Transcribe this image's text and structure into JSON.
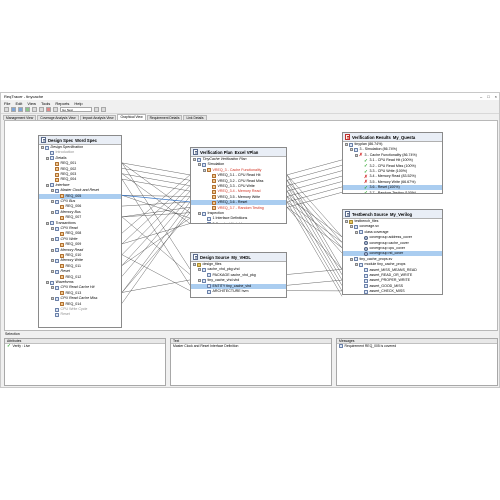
{
  "window": {
    "title": "ReqTracer - tinycache",
    "controls": [
      "–",
      "□",
      "×"
    ]
  },
  "menu": [
    "File",
    "Edit",
    "View",
    "Tools",
    "Reports",
    "Help"
  ],
  "toolbar": {
    "select_value": "Go Next"
  },
  "tabs": [
    {
      "label": "Management View",
      "active": false
    },
    {
      "label": "Coverage Analysis View",
      "active": false
    },
    {
      "label": "Impact Analysis View",
      "active": false
    },
    {
      "label": "Graphical View",
      "active": true
    },
    {
      "label": "Requirement Details",
      "active": false
    },
    {
      "label": "Link Details",
      "active": false
    }
  ],
  "panels": {
    "design_spec": {
      "title": "Design Spec",
      "subtitle": "Word Spec",
      "rows": [
        {
          "text": "Design Specification",
          "icon": "page",
          "exp": "-",
          "indent": 0,
          "style": "t-italic"
        },
        {
          "text": "Introduction",
          "icon": "page",
          "exp": "",
          "indent": 1,
          "style": "t-grey"
        },
        {
          "text": "Details",
          "icon": "page",
          "exp": "-",
          "indent": 1,
          "style": "t-italic"
        },
        {
          "text": "REQ_001",
          "icon": "req",
          "exp": "",
          "indent": 2,
          "style": ""
        },
        {
          "text": "REQ_002",
          "icon": "req",
          "exp": "",
          "indent": 2,
          "style": ""
        },
        {
          "text": "REQ_003",
          "icon": "req",
          "exp": "",
          "indent": 2,
          "style": ""
        },
        {
          "text": "REQ_004",
          "icon": "req",
          "exp": "",
          "indent": 2,
          "style": ""
        },
        {
          "text": "Interface",
          "icon": "page",
          "exp": "-",
          "indent": 1,
          "style": "t-italic"
        },
        {
          "text": "Master Clock and Reset",
          "icon": "page",
          "exp": "-",
          "indent": 2,
          "style": "t-italic"
        },
        {
          "text": "REQ_005",
          "icon": "req",
          "exp": "",
          "indent": 3,
          "style": "",
          "selected": true
        },
        {
          "text": "CPU Bus",
          "icon": "page",
          "exp": "-",
          "indent": 2,
          "style": "t-italic"
        },
        {
          "text": "REQ_006",
          "icon": "req",
          "exp": "",
          "indent": 3,
          "style": ""
        },
        {
          "text": "Memory Bus",
          "icon": "page",
          "exp": "-",
          "indent": 2,
          "style": "t-italic"
        },
        {
          "text": "REQ_007",
          "icon": "req",
          "exp": "",
          "indent": 3,
          "style": ""
        },
        {
          "text": "Transactions",
          "icon": "page",
          "exp": "-",
          "indent": 1,
          "style": "t-italic"
        },
        {
          "text": "CPU Read",
          "icon": "page",
          "exp": "-",
          "indent": 2,
          "style": "t-italic"
        },
        {
          "text": "REQ_008",
          "icon": "req",
          "exp": "",
          "indent": 3,
          "style": ""
        },
        {
          "text": "CPU Write",
          "icon": "page",
          "exp": "-",
          "indent": 2,
          "style": "t-italic"
        },
        {
          "text": "REQ_009",
          "icon": "req",
          "exp": "",
          "indent": 3,
          "style": ""
        },
        {
          "text": "Memory Read",
          "icon": "page",
          "exp": "-",
          "indent": 2,
          "style": "t-italic"
        },
        {
          "text": "REQ_010",
          "icon": "req",
          "exp": "",
          "indent": 3,
          "style": ""
        },
        {
          "text": "Memory Write",
          "icon": "page",
          "exp": "-",
          "indent": 2,
          "style": "t-italic"
        },
        {
          "text": "REQ_011",
          "icon": "req",
          "exp": "",
          "indent": 3,
          "style": ""
        },
        {
          "text": "Reset",
          "icon": "page",
          "exp": "-",
          "indent": 2,
          "style": "t-italic"
        },
        {
          "text": "REQ_012",
          "icon": "req",
          "exp": "",
          "indent": 3,
          "style": ""
        },
        {
          "text": "Waveforms",
          "icon": "page",
          "exp": "-",
          "indent": 1,
          "style": "t-italic"
        },
        {
          "text": "CPU Read Cache Hit",
          "icon": "page",
          "exp": "-",
          "indent": 2,
          "style": "t-italic"
        },
        {
          "text": "REQ_013",
          "icon": "req",
          "exp": "",
          "indent": 3,
          "style": ""
        },
        {
          "text": "CPU Read Cache Miss",
          "icon": "page",
          "exp": "-",
          "indent": 2,
          "style": "t-italic"
        },
        {
          "text": "REQ_014",
          "icon": "req",
          "exp": "",
          "indent": 3,
          "style": ""
        },
        {
          "text": "CPU Write Cycle",
          "icon": "page",
          "exp": "",
          "indent": 2,
          "style": "t-grey"
        },
        {
          "text": "Reset",
          "icon": "page",
          "exp": "",
          "indent": 2,
          "style": "t-grey"
        }
      ]
    },
    "verification_plan": {
      "title": "Verification Plan",
      "subtitle": "Excel VPlan",
      "rows": [
        {
          "text": "TinyCache Verification Plan",
          "icon": "page",
          "exp": "-",
          "indent": 0,
          "style": "t-italic"
        },
        {
          "text": "Simulation",
          "icon": "page",
          "exp": "-",
          "indent": 1,
          "style": ""
        },
        {
          "text": "VREQ_3 - Cache Functionality",
          "icon": "req",
          "exp": "-",
          "indent": 2,
          "style": "t-red"
        },
        {
          "text": "VREQ_3.1 - CPU Read Hit",
          "icon": "req",
          "exp": "",
          "indent": 3,
          "style": ""
        },
        {
          "text": "VREQ_3.2 - CPU Read Miss",
          "icon": "req",
          "exp": "",
          "indent": 3,
          "style": ""
        },
        {
          "text": "VREQ_3.3 - CPU Write",
          "icon": "req",
          "exp": "",
          "indent": 3,
          "style": ""
        },
        {
          "text": "VREQ_3.4 - Memory Read",
          "icon": "req",
          "exp": "",
          "indent": 3,
          "style": "t-red"
        },
        {
          "text": "VREQ_3.5 - Memory Write",
          "icon": "req",
          "exp": "",
          "indent": 3,
          "style": ""
        },
        {
          "text": "VREQ_3.6 - Reset",
          "icon": "req",
          "exp": "",
          "indent": 3,
          "style": "",
          "selected": true
        },
        {
          "text": "VREQ_3.7 - Random Testing",
          "icon": "req",
          "exp": "",
          "indent": 3,
          "style": "t-red"
        },
        {
          "text": "Inspection",
          "icon": "page",
          "exp": "-",
          "indent": 1,
          "style": ""
        },
        {
          "text": "1 Interface Definitions",
          "icon": "page",
          "exp": "",
          "indent": 2,
          "style": ""
        },
        {
          "text": "2 Constant Variables",
          "icon": "page",
          "exp": "",
          "indent": 2,
          "style": ""
        }
      ]
    },
    "design_source": {
      "title": "Design Source",
      "subtitle": "My_VHDL",
      "rows": [
        {
          "text": "design_files",
          "icon": "folder",
          "exp": "-",
          "indent": 0,
          "style": ""
        },
        {
          "text": "cache_vhd_pkg.vhd",
          "icon": "page",
          "exp": "-",
          "indent": 1,
          "style": ""
        },
        {
          "text": "PACKAGE cache_vhd_pkg",
          "icon": "page",
          "exp": "",
          "indent": 2,
          "style": ""
        },
        {
          "text": "tiny_cache_vhd.vhd",
          "icon": "page",
          "exp": "-",
          "indent": 1,
          "style": ""
        },
        {
          "text": "ENTITY tiny_cache_vhd",
          "icon": "page",
          "exp": "",
          "indent": 2,
          "style": "",
          "selected": true
        },
        {
          "text": "ARCHITECTURE hvm",
          "icon": "page",
          "exp": "",
          "indent": 2,
          "style": ""
        }
      ]
    },
    "verification_results": {
      "title": "Verification Results",
      "subtitle": "My_Questa",
      "rows": [
        {
          "text": "tinyplan (86.74%)",
          "icon": "page",
          "exp": "-",
          "indent": 0,
          "style": ""
        },
        {
          "text": "3 - Simulation (86.74%)",
          "icon": "page",
          "exp": "-",
          "indent": 1,
          "style": ""
        },
        {
          "text": "3 - Cache Functionality (86.74%)",
          "icon": "cross",
          "exp": "-",
          "indent": 2,
          "style": ""
        },
        {
          "text": "3.1 - CPU Read Hit (100%)",
          "icon": "check",
          "exp": "",
          "indent": 3,
          "style": ""
        },
        {
          "text": "3.2 - CPU Read Miss (100%)",
          "icon": "check",
          "exp": "",
          "indent": 3,
          "style": ""
        },
        {
          "text": "3.3 - CPU Write (100%)",
          "icon": "check",
          "exp": "",
          "indent": 3,
          "style": ""
        },
        {
          "text": "3.4 - Memory Read (83.52%)",
          "icon": "cross",
          "exp": "",
          "indent": 3,
          "style": ""
        },
        {
          "text": "3.5 - Memory Write (66.67%)",
          "icon": "cross",
          "exp": "",
          "indent": 3,
          "style": ""
        },
        {
          "text": "3.6 - Reset (100%)",
          "icon": "check",
          "exp": "",
          "indent": 3,
          "style": "",
          "selected": true
        },
        {
          "text": "3.7 - Random Testing (100%)",
          "icon": "check",
          "exp": "",
          "indent": 3,
          "style": ""
        }
      ]
    },
    "testbench_source": {
      "title": "Testbench Source",
      "subtitle": "My_Verilog",
      "rows": [
        {
          "text": "testbench_files",
          "icon": "folder",
          "exp": "-",
          "indent": 0,
          "style": ""
        },
        {
          "text": "coverage.sv",
          "icon": "page",
          "exp": "-",
          "indent": 1,
          "style": ""
        },
        {
          "text": "class coverage",
          "icon": "page",
          "exp": "-",
          "indent": 2,
          "style": ""
        },
        {
          "text": "covergroup address_cover",
          "icon": "gear",
          "exp": "",
          "indent": 3,
          "style": ""
        },
        {
          "text": "covergroup cache_cover",
          "icon": "gear",
          "exp": "",
          "indent": 3,
          "style": ""
        },
        {
          "text": "covergroup cpu_cover",
          "icon": "gear",
          "exp": "",
          "indent": 3,
          "style": ""
        },
        {
          "text": "covergroup rst_cover",
          "icon": "gear",
          "exp": "",
          "indent": 3,
          "style": "",
          "selected": true
        },
        {
          "text": "tiny_cache_props.sv",
          "icon": "page",
          "exp": "-",
          "indent": 1,
          "style": ""
        },
        {
          "text": "module tiny_cache_props",
          "icon": "page",
          "exp": "-",
          "indent": 2,
          "style": ""
        },
        {
          "text": "assert_MISS_MEANS_READ",
          "icon": "page",
          "exp": "",
          "indent": 3,
          "style": ""
        },
        {
          "text": "assert_READ_OR_WRITE",
          "icon": "page",
          "exp": "",
          "indent": 3,
          "style": ""
        },
        {
          "text": "assert_PROPER_WRITE",
          "icon": "page",
          "exp": "",
          "indent": 3,
          "style": ""
        },
        {
          "text": "assert_GOOD_MISS",
          "icon": "page",
          "exp": "",
          "indent": 3,
          "style": ""
        },
        {
          "text": "assert_CHECK_MISS",
          "icon": "page",
          "exp": "",
          "indent": 3,
          "style": ""
        },
        {
          "text": "assert_MEM_WR_MEANS_CPU_WR",
          "icon": "page",
          "exp": "",
          "indent": 3,
          "style": ""
        }
      ]
    }
  },
  "bottom": {
    "section_title": "Selection",
    "attributes": {
      "header": "Attributes",
      "row": "Verify : Live"
    },
    "text": {
      "header": "Text",
      "row": "Master Clock and Reset Interface Definition"
    },
    "messages": {
      "header": "Messages",
      "row": "Requirement REQ_005 is covered"
    }
  },
  "colors": {
    "selection": "#aacdf0",
    "link_line": "#404040",
    "header_bg": "#e9eef6",
    "failed_text": "#d03020",
    "pass_check": "#20a020"
  }
}
